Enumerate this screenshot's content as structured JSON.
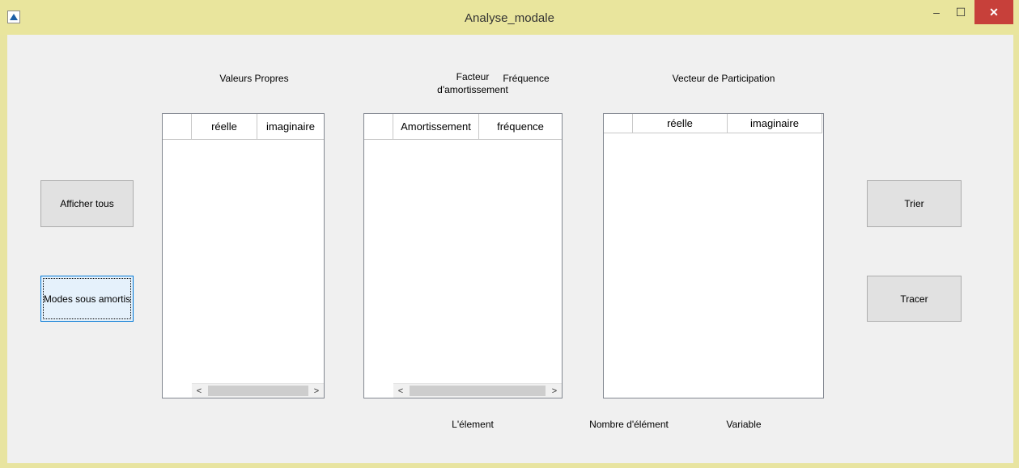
{
  "window": {
    "title": "Analyse_modale",
    "minimize_glyph": "–",
    "maximize_glyph": "☐",
    "close_glyph": "✕",
    "app_icon": "matlab-icon"
  },
  "labels": {
    "valeurs_propres": "Valeurs Propres",
    "facteur_line1": "Facteur",
    "facteur_line2": "d'amortissement",
    "frequence": "Fréquence",
    "vecteur_participation": "Vecteur de Participation",
    "element": "L'élement",
    "nombre_element": "Nombre d'élément",
    "variable": "Variable"
  },
  "buttons": {
    "afficher_tous": "Afficher tous",
    "modes_sous_amortis": "Modes sous amortis",
    "trier": "Trier",
    "tracer": "Tracer"
  },
  "tables": {
    "valeurs_propres": {
      "columns": [
        "",
        "réelle",
        "imaginaire"
      ],
      "rows": []
    },
    "facteur_frequence": {
      "columns": [
        "",
        "Amortissement",
        "fréquence"
      ],
      "rows": []
    },
    "vecteur_participation": {
      "columns": [
        "",
        "réelle",
        "imaginaire"
      ],
      "rows": []
    }
  },
  "scroll": {
    "left_arrow": "<",
    "right_arrow": ">"
  }
}
